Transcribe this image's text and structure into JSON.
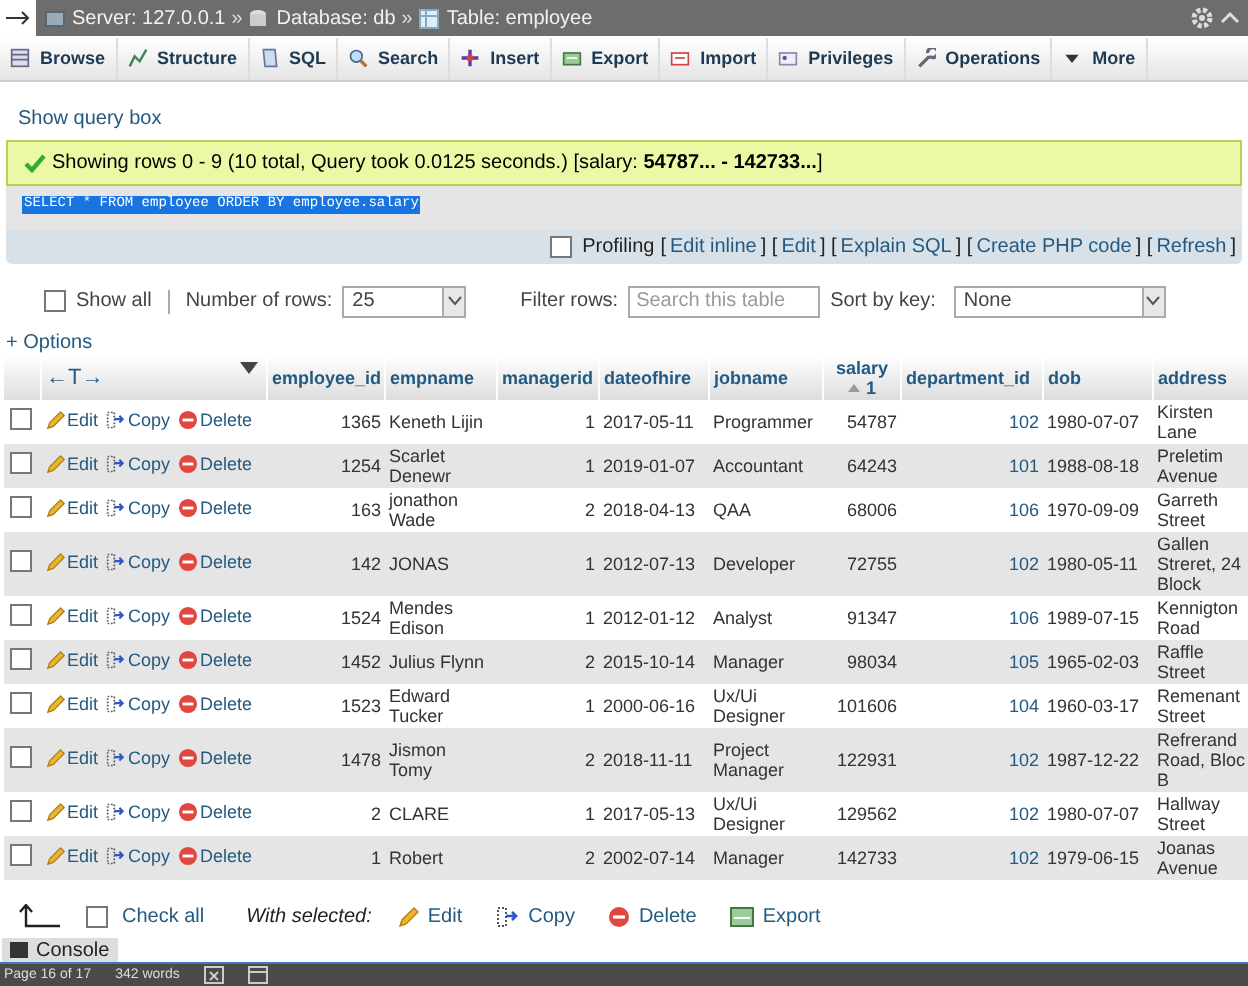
{
  "breadcrumb": [
    {
      "label": "Server: 127.0.0.1"
    },
    {
      "prefix": "»",
      "label": "Database: db"
    },
    {
      "prefix": "»",
      "label": "Table: employee"
    }
  ],
  "tabs": [
    {
      "label": "Browse"
    },
    {
      "label": "Structure"
    },
    {
      "label": "SQL"
    },
    {
      "label": "Search"
    },
    {
      "label": "Insert"
    },
    {
      "label": "Export"
    },
    {
      "label": "Import"
    },
    {
      "label": "Privileges"
    },
    {
      "label": "Operations"
    },
    {
      "label": "More"
    }
  ],
  "show_query_box": "Show query box",
  "message": "Showing rows 0 - 9 (10 total, Query took 0.0125 seconds.) [salary: **54787... - 142733...**]",
  "query": "SELECT * FROM employee ORDER BY employee.salary",
  "profiling": {
    "label": "Profiling",
    "checked": false,
    "segments": [
      {
        "kind": "text",
        "text": "["
      },
      {
        "kind": "link",
        "text": "Edit inline"
      },
      {
        "kind": "text",
        "text": "] ["
      },
      {
        "kind": "link",
        "text": "Edit"
      },
      {
        "kind": "text",
        "text": "] ["
      },
      {
        "kind": "link",
        "text": "Explain SQL"
      },
      {
        "kind": "text",
        "text": "] ["
      },
      {
        "kind": "link",
        "text": "Create PHP code"
      },
      {
        "kind": "text",
        "text": "] ["
      },
      {
        "kind": "link",
        "text": "Refresh"
      },
      {
        "kind": "text",
        "text": "]"
      }
    ]
  },
  "controls": {
    "show_all": {
      "label": "Show all",
      "checked": false
    },
    "rows_label": "Number of rows:",
    "rows_value": "25",
    "filter_label": "Filter rows:",
    "filter_placeholder": "Search this table",
    "sort_label": "Sort by key:",
    "sort_value": "None"
  },
  "options": "+ Options",
  "table": {
    "resize_label": "←T→",
    "columns": [
      {
        "label": "employee_id",
        "kind": "number"
      },
      {
        "label": "empname",
        "kind": "text"
      },
      {
        "label": "managerid",
        "kind": "number"
      },
      {
        "label": "dateofhire",
        "kind": "date"
      },
      {
        "label": "jobname",
        "kind": "text"
      },
      {
        "label": "salary",
        "kind": "number",
        "sort": "1"
      },
      {
        "label": "department_id",
        "kind": "link"
      },
      {
        "label": "dob",
        "kind": "date"
      },
      {
        "label": "address",
        "kind": "text"
      }
    ],
    "rows": [
      {
        "selected": false,
        "actions": [
          "Edit",
          "Copy",
          "Delete"
        ],
        "cells": [
          "1365",
          "Keneth Lijin",
          "1",
          "2017-05-11",
          "Programmer",
          "54787",
          "102",
          "1980-07-07",
          "Kirsten Lane"
        ]
      },
      {
        "selected": false,
        "actions": [
          "Edit",
          "Copy",
          "Delete"
        ],
        "cells": [
          "1254",
          "Scarlet Denewr",
          "1",
          "2019-01-07",
          "Accountant",
          "64243",
          "101",
          "1988-08-18",
          "Preletim Avenue"
        ]
      },
      {
        "selected": false,
        "actions": [
          "Edit",
          "Copy",
          "Delete"
        ],
        "cells": [
          "163",
          "jonathon Wade",
          "2",
          "2018-04-13",
          "QAA",
          "68006",
          "106",
          "1970-09-09",
          "Garreth Street"
        ]
      },
      {
        "selected": false,
        "actions": [
          "Edit",
          "Copy",
          "Delete"
        ],
        "cells": [
          "142",
          "JONAS",
          "1",
          "2012-07-13",
          "Developer",
          "72755",
          "102",
          "1980-05-11",
          "Gallen Streret, 24 Block"
        ]
      },
      {
        "selected": false,
        "actions": [
          "Edit",
          "Copy",
          "Delete"
        ],
        "cells": [
          "1524",
          "Mendes Edison",
          "1",
          "2012-01-12",
          "Analyst",
          "91347",
          "106",
          "1989-07-15",
          "Kennigton Road"
        ]
      },
      {
        "selected": false,
        "actions": [
          "Edit",
          "Copy",
          "Delete"
        ],
        "cells": [
          "1452",
          "Julius Flynn",
          "2",
          "2015-10-14",
          "Manager",
          "98034",
          "105",
          "1965-02-03",
          "Raffle Street"
        ]
      },
      {
        "selected": false,
        "actions": [
          "Edit",
          "Copy",
          "Delete"
        ],
        "cells": [
          "1523",
          "Edward Tucker",
          "1",
          "2000-06-16",
          "Ux/Ui Designer",
          "101606",
          "104",
          "1960-03-17",
          "Remenant Street"
        ]
      },
      {
        "selected": false,
        "actions": [
          "Edit",
          "Copy",
          "Delete"
        ],
        "cells": [
          "1478",
          "Jismon Tomy",
          "2",
          "2018-11-11",
          "Project Manager",
          "122931",
          "102",
          "1987-12-22",
          "Refrerand Road, Bloc B"
        ]
      },
      {
        "selected": false,
        "actions": [
          "Edit",
          "Copy",
          "Delete"
        ],
        "cells": [
          "2",
          "CLARE",
          "1",
          "2017-05-13",
          "Ux/Ui Designer",
          "129562",
          "102",
          "1980-07-07",
          "Hallway Street"
        ]
      },
      {
        "selected": false,
        "actions": [
          "Edit",
          "Copy",
          "Delete"
        ],
        "cells": [
          "1",
          "Robert",
          "2",
          "2002-07-14",
          "Manager",
          "142733",
          "102",
          "1979-06-15",
          "Joanas Avenue"
        ]
      }
    ]
  },
  "bulk": {
    "check_all": {
      "label": "Check all",
      "checked": false
    },
    "with_selected": "With selected:",
    "buttons": [
      "Edit",
      "Copy",
      "Delete",
      "Export"
    ]
  },
  "console": "Console",
  "status_bar": {
    "page": "Page 16 of 17",
    "words": "342 words"
  }
}
